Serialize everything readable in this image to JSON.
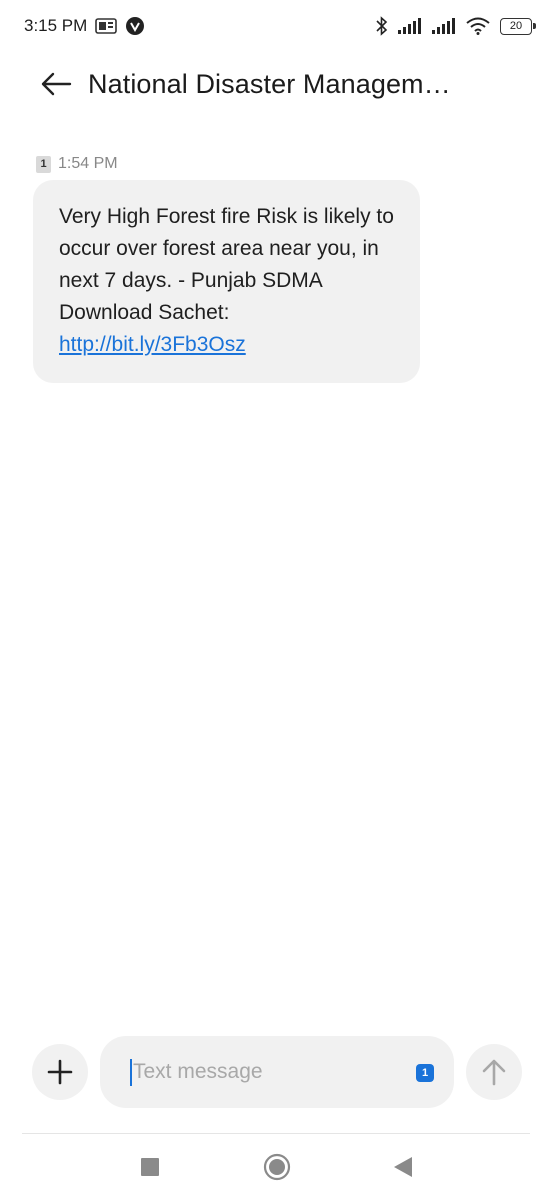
{
  "status_bar": {
    "time": "3:15 PM",
    "battery": "20",
    "icons": [
      "notification-icon",
      "vpn-icon",
      "bluetooth-icon",
      "signal-icon",
      "signal-icon",
      "wifi-icon",
      "battery-icon"
    ]
  },
  "header": {
    "title": "National Disaster Managem…"
  },
  "message": {
    "sim": "1",
    "time": "1:54 PM",
    "body": "Very High Forest fire Risk is likely to occur over forest area near you, in next 7 days. - Punjab SDMA Download Sachet: ",
    "link": "http://bit.ly/3Fb3Osz"
  },
  "composer": {
    "placeholder": "Text message",
    "sim": "1"
  },
  "colors": {
    "accent": "#1a73d9",
    "bubble": "#f1f1f1"
  }
}
